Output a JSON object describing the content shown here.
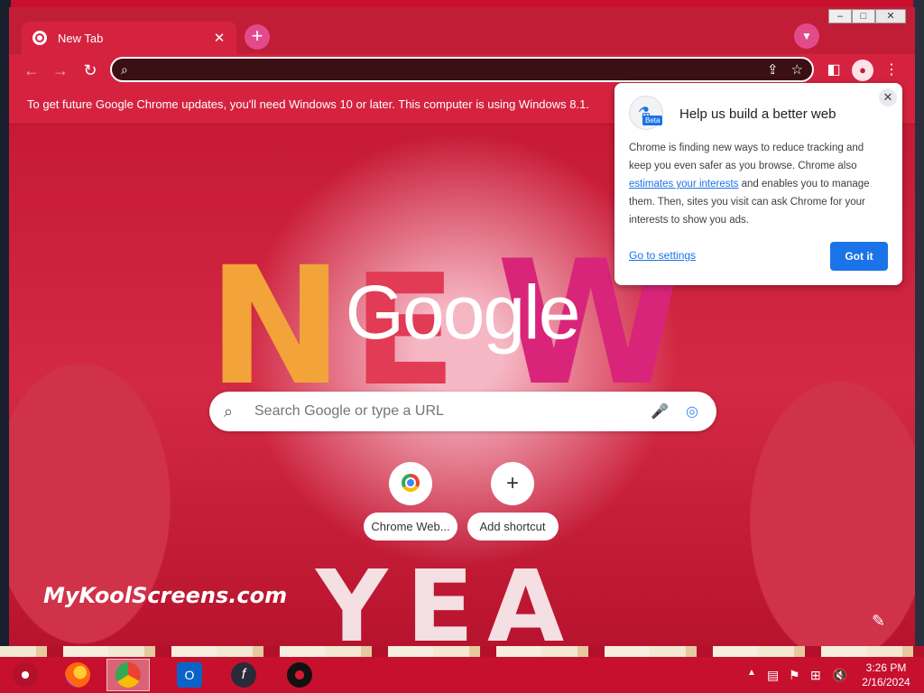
{
  "tab": {
    "title": "New Tab"
  },
  "window_controls": {
    "minimize": "–",
    "maximize": "□",
    "close": "✕"
  },
  "toolbar": {
    "back": "←",
    "forward": "→",
    "reload": "↻",
    "omnibox_value": ""
  },
  "infobar": {
    "message": "To get future Google Chrome updates, you'll need Windows 10 or later. This computer is using Windows 8.1."
  },
  "ntp": {
    "logo": "Google",
    "search_placeholder": "Search Google or type a URL",
    "shortcuts": [
      {
        "label": "Chrome Web...",
        "icon": "chrome-webstore-icon"
      },
      {
        "label": "Add shortcut",
        "icon": "plus-icon"
      }
    ],
    "watermark": "MyKoolScreens.com"
  },
  "bubble": {
    "badge": "Beta",
    "title": "Help us build a better web",
    "body_pre": "Chrome is finding new ways to reduce tracking and keep you even safer as you browse. Chrome also",
    "body_link": "estimates your interests",
    "body_post": "and enables you to manage them. Then, sites you visit can ask Chrome for your interests to show you ads.",
    "settings_link": "Go to settings",
    "ok_button": "Got it"
  },
  "taskbar": {
    "apps": [
      "firefox-icon",
      "chrome-icon",
      "outlook-icon",
      "flash-icon",
      "recorder-icon"
    ],
    "time": "3:26 PM",
    "date": "2/16/2024"
  },
  "colors": {
    "accent": "#1a73e8",
    "theme_red": "#c7203a"
  }
}
